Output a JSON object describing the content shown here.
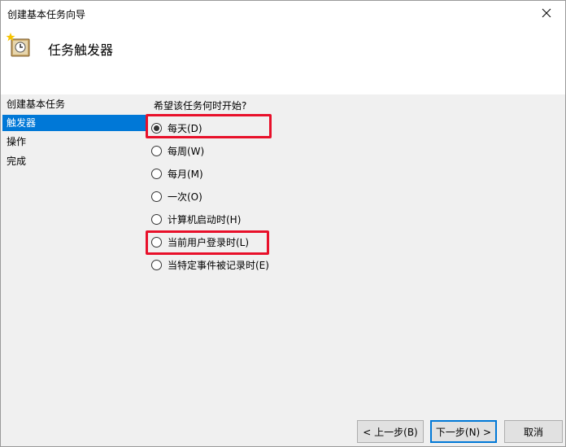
{
  "window": {
    "title": "创建基本任务向导"
  },
  "header": {
    "title": "任务触发器"
  },
  "sidebar": {
    "items": [
      {
        "label": "创建基本任务"
      },
      {
        "label": "触发器"
      },
      {
        "label": "操作"
      },
      {
        "label": "完成"
      }
    ]
  },
  "main": {
    "question": "希望该任务何时开始?",
    "options": [
      {
        "label": "每天(D)",
        "selected": true
      },
      {
        "label": "每周(W)",
        "selected": false
      },
      {
        "label": "每月(M)",
        "selected": false
      },
      {
        "label": "一次(O)",
        "selected": false
      },
      {
        "label": "计算机启动时(H)",
        "selected": false
      },
      {
        "label": "当前用户登录时(L)",
        "selected": false
      },
      {
        "label": "当特定事件被记录时(E)",
        "selected": false
      }
    ]
  },
  "footer": {
    "back_label": "< 上一步(B)",
    "next_label": "下一步(N) >",
    "cancel_label": "取消"
  },
  "colors": {
    "accent": "#0078d7",
    "highlight": "#e8102a"
  }
}
